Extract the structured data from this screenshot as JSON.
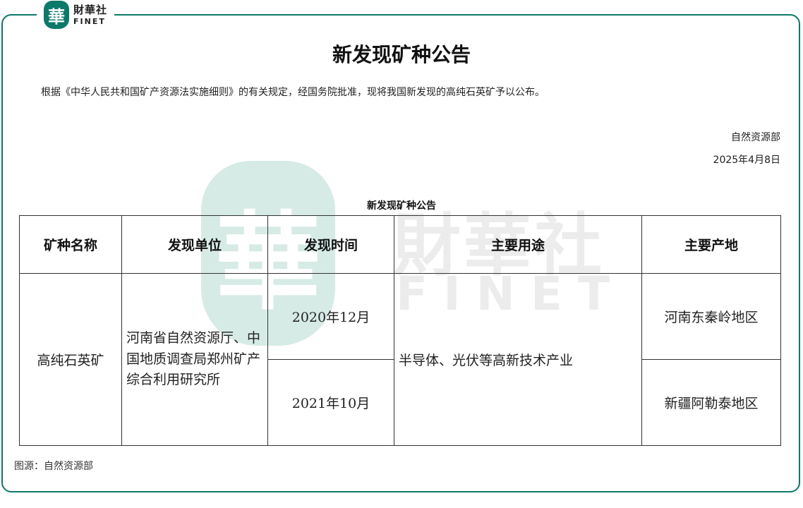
{
  "brand": {
    "logo_char": "華",
    "name_cn": "財華社",
    "name_en": "FINET"
  },
  "document": {
    "title": "新发现矿种公告",
    "intro": "根据《中华人民共和国矿产资源法实施细则》的有关规定，经国务院批准，现将我国新发现的高纯石英矿予以公布。",
    "issuer": "自然资源部",
    "date": "2025年4月8日",
    "table_caption": "新发现矿种公告",
    "source": "图源：自然资源部"
  },
  "table": {
    "headers": [
      "矿种名称",
      "发现单位",
      "发现时间",
      "主要用途",
      "主要产地"
    ],
    "mineral": "高纯石英矿",
    "unit": "河南省自然资源厅、中国地质调查局郑州矿产综合利用研究所",
    "times": [
      "2020年12月",
      "2021年10月"
    ],
    "use": "半导体、光伏等高新技术产业",
    "regions": [
      "河南东秦岭地区",
      "新疆阿勒泰地区"
    ]
  },
  "colors": {
    "brand_teal": "#0b7a6a",
    "watermark_teal": "#d6ebe6"
  }
}
